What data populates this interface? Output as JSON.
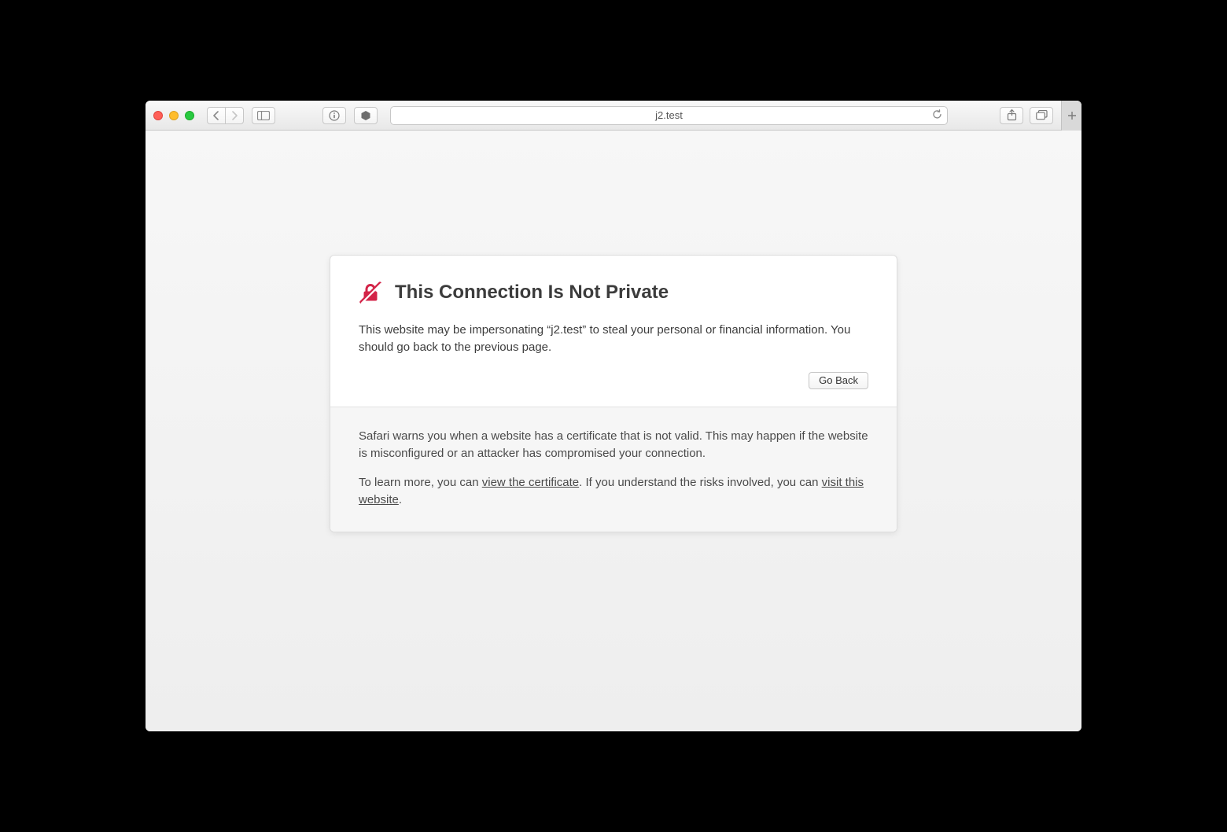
{
  "toolbar": {
    "address": "j2.test"
  },
  "warning": {
    "title": "This Connection Is Not Private",
    "body": "This website may be impersonating “j2.test” to steal your personal or financial information. You should go back to the previous page.",
    "go_back_label": "Go Back"
  },
  "details": {
    "explain": "Safari warns you when a website has a certificate that is not valid. This may happen if the website is misconfigured or an attacker has compromised your connection.",
    "learn_prefix": "To learn more, you can ",
    "view_cert_link": "view the certificate",
    "learn_mid": ". If you understand the risks involved, you can ",
    "visit_link": "visit this website",
    "learn_suffix": "."
  }
}
